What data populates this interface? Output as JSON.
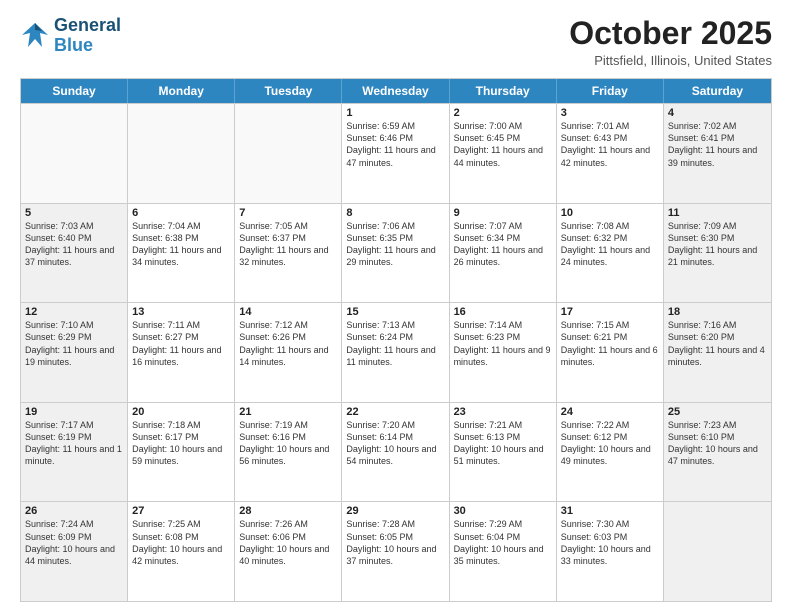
{
  "header": {
    "logo_line1": "General",
    "logo_line2": "Blue",
    "month": "October 2025",
    "location": "Pittsfield, Illinois, United States"
  },
  "days_of_week": [
    "Sunday",
    "Monday",
    "Tuesday",
    "Wednesday",
    "Thursday",
    "Friday",
    "Saturday"
  ],
  "rows": [
    [
      {
        "day": "",
        "text": "",
        "shaded": false
      },
      {
        "day": "",
        "text": "",
        "shaded": false
      },
      {
        "day": "",
        "text": "",
        "shaded": false
      },
      {
        "day": "1",
        "text": "Sunrise: 6:59 AM\nSunset: 6:46 PM\nDaylight: 11 hours\nand 47 minutes.",
        "shaded": false
      },
      {
        "day": "2",
        "text": "Sunrise: 7:00 AM\nSunset: 6:45 PM\nDaylight: 11 hours\nand 44 minutes.",
        "shaded": false
      },
      {
        "day": "3",
        "text": "Sunrise: 7:01 AM\nSunset: 6:43 PM\nDaylight: 11 hours\nand 42 minutes.",
        "shaded": false
      },
      {
        "day": "4",
        "text": "Sunrise: 7:02 AM\nSunset: 6:41 PM\nDaylight: 11 hours\nand 39 minutes.",
        "shaded": true
      }
    ],
    [
      {
        "day": "5",
        "text": "Sunrise: 7:03 AM\nSunset: 6:40 PM\nDaylight: 11 hours\nand 37 minutes.",
        "shaded": true
      },
      {
        "day": "6",
        "text": "Sunrise: 7:04 AM\nSunset: 6:38 PM\nDaylight: 11 hours\nand 34 minutes.",
        "shaded": false
      },
      {
        "day": "7",
        "text": "Sunrise: 7:05 AM\nSunset: 6:37 PM\nDaylight: 11 hours\nand 32 minutes.",
        "shaded": false
      },
      {
        "day": "8",
        "text": "Sunrise: 7:06 AM\nSunset: 6:35 PM\nDaylight: 11 hours\nand 29 minutes.",
        "shaded": false
      },
      {
        "day": "9",
        "text": "Sunrise: 7:07 AM\nSunset: 6:34 PM\nDaylight: 11 hours\nand 26 minutes.",
        "shaded": false
      },
      {
        "day": "10",
        "text": "Sunrise: 7:08 AM\nSunset: 6:32 PM\nDaylight: 11 hours\nand 24 minutes.",
        "shaded": false
      },
      {
        "day": "11",
        "text": "Sunrise: 7:09 AM\nSunset: 6:30 PM\nDaylight: 11 hours\nand 21 minutes.",
        "shaded": true
      }
    ],
    [
      {
        "day": "12",
        "text": "Sunrise: 7:10 AM\nSunset: 6:29 PM\nDaylight: 11 hours\nand 19 minutes.",
        "shaded": true
      },
      {
        "day": "13",
        "text": "Sunrise: 7:11 AM\nSunset: 6:27 PM\nDaylight: 11 hours\nand 16 minutes.",
        "shaded": false
      },
      {
        "day": "14",
        "text": "Sunrise: 7:12 AM\nSunset: 6:26 PM\nDaylight: 11 hours\nand 14 minutes.",
        "shaded": false
      },
      {
        "day": "15",
        "text": "Sunrise: 7:13 AM\nSunset: 6:24 PM\nDaylight: 11 hours\nand 11 minutes.",
        "shaded": false
      },
      {
        "day": "16",
        "text": "Sunrise: 7:14 AM\nSunset: 6:23 PM\nDaylight: 11 hours\nand 9 minutes.",
        "shaded": false
      },
      {
        "day": "17",
        "text": "Sunrise: 7:15 AM\nSunset: 6:21 PM\nDaylight: 11 hours\nand 6 minutes.",
        "shaded": false
      },
      {
        "day": "18",
        "text": "Sunrise: 7:16 AM\nSunset: 6:20 PM\nDaylight: 11 hours\nand 4 minutes.",
        "shaded": true
      }
    ],
    [
      {
        "day": "19",
        "text": "Sunrise: 7:17 AM\nSunset: 6:19 PM\nDaylight: 11 hours\nand 1 minute.",
        "shaded": true
      },
      {
        "day": "20",
        "text": "Sunrise: 7:18 AM\nSunset: 6:17 PM\nDaylight: 10 hours\nand 59 minutes.",
        "shaded": false
      },
      {
        "day": "21",
        "text": "Sunrise: 7:19 AM\nSunset: 6:16 PM\nDaylight: 10 hours\nand 56 minutes.",
        "shaded": false
      },
      {
        "day": "22",
        "text": "Sunrise: 7:20 AM\nSunset: 6:14 PM\nDaylight: 10 hours\nand 54 minutes.",
        "shaded": false
      },
      {
        "day": "23",
        "text": "Sunrise: 7:21 AM\nSunset: 6:13 PM\nDaylight: 10 hours\nand 51 minutes.",
        "shaded": false
      },
      {
        "day": "24",
        "text": "Sunrise: 7:22 AM\nSunset: 6:12 PM\nDaylight: 10 hours\nand 49 minutes.",
        "shaded": false
      },
      {
        "day": "25",
        "text": "Sunrise: 7:23 AM\nSunset: 6:10 PM\nDaylight: 10 hours\nand 47 minutes.",
        "shaded": true
      }
    ],
    [
      {
        "day": "26",
        "text": "Sunrise: 7:24 AM\nSunset: 6:09 PM\nDaylight: 10 hours\nand 44 minutes.",
        "shaded": true
      },
      {
        "day": "27",
        "text": "Sunrise: 7:25 AM\nSunset: 6:08 PM\nDaylight: 10 hours\nand 42 minutes.",
        "shaded": false
      },
      {
        "day": "28",
        "text": "Sunrise: 7:26 AM\nSunset: 6:06 PM\nDaylight: 10 hours\nand 40 minutes.",
        "shaded": false
      },
      {
        "day": "29",
        "text": "Sunrise: 7:28 AM\nSunset: 6:05 PM\nDaylight: 10 hours\nand 37 minutes.",
        "shaded": false
      },
      {
        "day": "30",
        "text": "Sunrise: 7:29 AM\nSunset: 6:04 PM\nDaylight: 10 hours\nand 35 minutes.",
        "shaded": false
      },
      {
        "day": "31",
        "text": "Sunrise: 7:30 AM\nSunset: 6:03 PM\nDaylight: 10 hours\nand 33 minutes.",
        "shaded": false
      },
      {
        "day": "",
        "text": "",
        "shaded": true
      }
    ]
  ]
}
